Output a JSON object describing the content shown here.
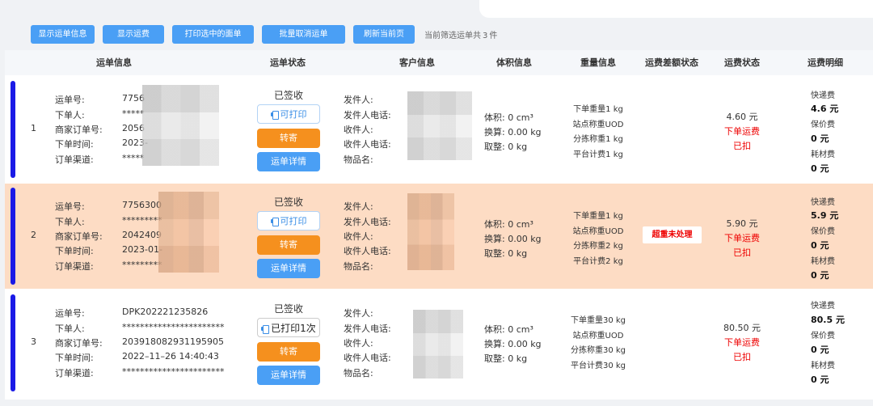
{
  "toolbar": {
    "buttons": [
      "显示运单信息",
      "显示运费",
      "打印选中的面单",
      "批量取消运单",
      "刷新当前页"
    ],
    "selected_prefix": "当前筛选运单共",
    "selected_count": "3",
    "selected_suffix": "件"
  },
  "table": {
    "headers": [
      "运单信息",
      "运单状态",
      "客户信息",
      "体积信息",
      "重量信息",
      "运费差额状态",
      "运费状态",
      "运费明细"
    ],
    "info_labels": [
      "运单号:",
      "下单人:",
      "商家订单号:",
      "下单时间:",
      "订单渠道:"
    ],
    "customer_labels": [
      "发件人:",
      "发件人电话:",
      "收件人:",
      "收件人电话:",
      "物品名:"
    ],
    "rows": [
      {
        "index": "1",
        "waybill_no": "7756",
        "orderer": "*****",
        "merchant_order_no": "2056",
        "order_time": "2023-",
        "channel": "*****",
        "status": "已签收",
        "print_label": "可打印",
        "transfer_label": "转寄",
        "detail_label": "运单详情",
        "volume": "体积:  0 cm³",
        "converted": "换算:  0.00 kg",
        "rounded": "取整:  0 kg",
        "weight_order": "下单重量1 kg",
        "weight_station": "站点称重UOD",
        "weight_sort": "分拣称重1 kg",
        "weight_platform": "平台计费1 kg",
        "diff_status": "",
        "fee_amount": "4.60 元",
        "fee_type": "下单运费",
        "fee_status": "已扣",
        "express_label": "快递费",
        "express_value": "4.6 元",
        "insurance_label": "保价费",
        "insurance_value": "0 元",
        "material_label": "耗材费",
        "material_value": "0 元"
      },
      {
        "index": "2",
        "waybill_no": "7756300",
        "orderer": "*********",
        "merchant_order_no": "2042409",
        "order_time": "2023-01-",
        "channel": "*********",
        "status": "已签收",
        "print_label": "可打印",
        "transfer_label": "转寄",
        "detail_label": "运单详情",
        "volume": "体积:  0 cm³",
        "converted": "换算:  0.00 kg",
        "rounded": "取整:  0 kg",
        "weight_order": "下单重量1 kg",
        "weight_station": "站点称重UOD",
        "weight_sort": "分拣称重2 kg",
        "weight_platform": "平台计费2 kg",
        "diff_status": "超重未处理",
        "fee_amount": "5.90 元",
        "fee_type": "下单运费",
        "fee_status": "已扣",
        "express_label": "快递费",
        "express_value": "5.9 元",
        "insurance_label": "保价费",
        "insurance_value": "0 元",
        "material_label": "耗材费",
        "material_value": "0 元"
      },
      {
        "index": "3",
        "waybill_no": "DPK202221235826",
        "orderer": "***********************",
        "merchant_order_no": "203918082931195905",
        "order_time": "2022–11–26 14:40:43",
        "channel": "***********************",
        "status": "已签收",
        "print_label": "已打印1次",
        "transfer_label": "转寄",
        "detail_label": "运单详情",
        "volume": "体积:  0 cm³",
        "converted": "换算:  0.00 kg",
        "rounded": "取整:  0 kg",
        "weight_order": "下单重量30 kg",
        "weight_station": "站点称重UOD",
        "weight_sort": "分拣称重30 kg",
        "weight_platform": "平台计费30 kg",
        "diff_status": "",
        "fee_amount": "80.50 元",
        "fee_type": "下单运费",
        "fee_status": "已扣",
        "express_label": "快递费",
        "express_value": "80.5 元",
        "insurance_label": "保价费",
        "insurance_value": "0 元",
        "material_label": "耗材费",
        "material_value": "0 元"
      }
    ]
  }
}
